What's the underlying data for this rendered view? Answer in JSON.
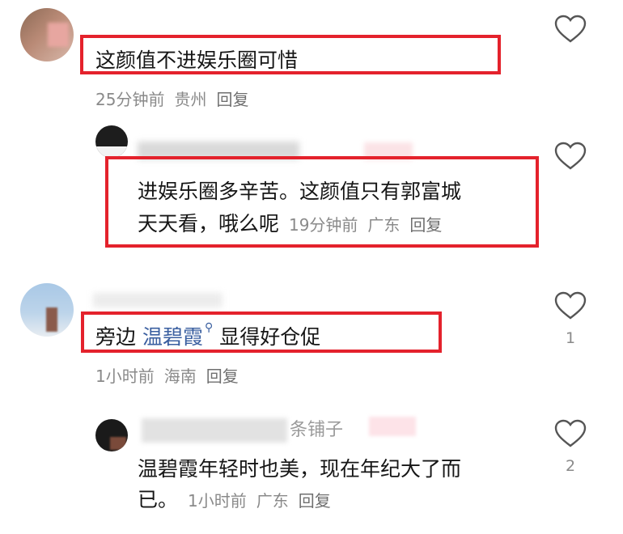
{
  "comments": [
    {
      "text": "这颜值不进娱乐圈可惜",
      "time": "25分钟前",
      "location": "贵州",
      "reply_label": "回复"
    },
    {
      "text_line1": "进娱乐圈多辛苦。这颜值只有郭富城",
      "text_line2": "天天看，哦么呢",
      "time": "19分钟前",
      "location": "广东",
      "reply_label": "回复"
    },
    {
      "text_before": "旁边",
      "link_text": "温碧霞",
      "text_after": "显得好仓促",
      "time": "1小时前",
      "location": "海南",
      "reply_label": "回复",
      "like_count": "1"
    },
    {
      "username_suffix": "条铺子",
      "text_line1": "温碧霞年轻时也美，现在年纪大了而",
      "text_line2": "已。",
      "time": "1小时前",
      "location": "广东",
      "reply_label": "回复",
      "like_count": "2"
    }
  ]
}
